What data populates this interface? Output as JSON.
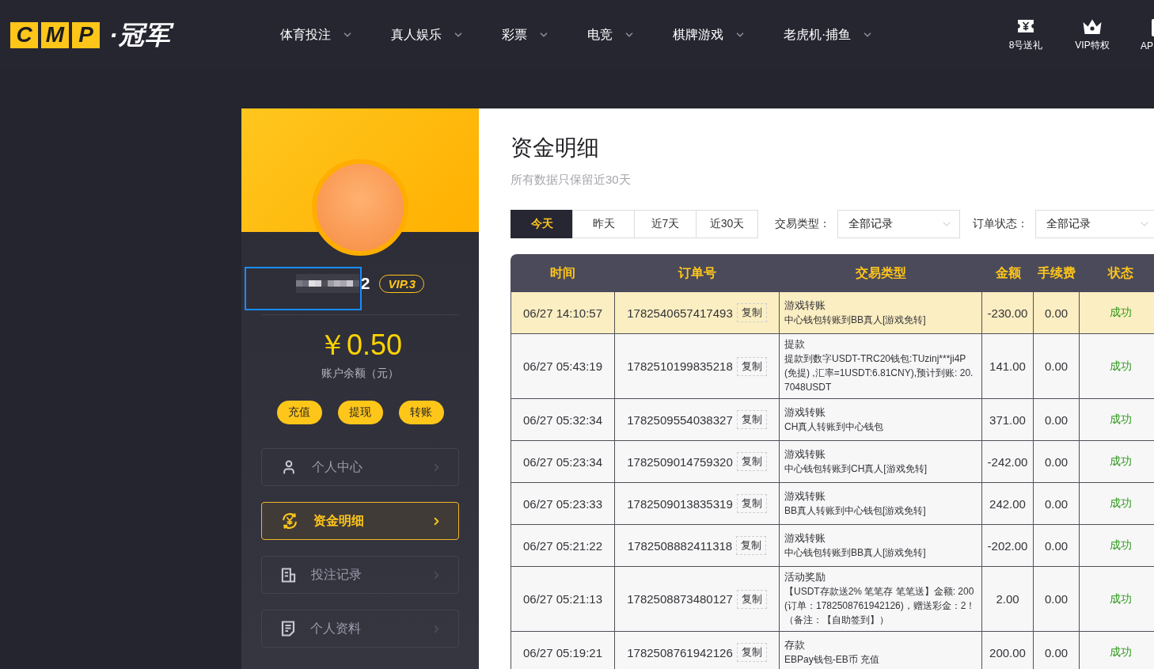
{
  "header": {
    "logo": {
      "letters": [
        "C",
        "M",
        "P"
      ],
      "name": "·冠军"
    },
    "nav": [
      {
        "label": "体育投注"
      },
      {
        "label": "真人娱乐"
      },
      {
        "label": "彩票"
      },
      {
        "label": "电竞"
      },
      {
        "label": "棋牌游戏"
      },
      {
        "label": "老虎机·捕鱼"
      }
    ],
    "actions": [
      {
        "kind": "ticket",
        "label": "8号送礼"
      },
      {
        "kind": "crown",
        "label": "VIP特权"
      },
      {
        "kind": "app",
        "label": "AP"
      }
    ]
  },
  "sidebar": {
    "username": "2",
    "name_highlighted": true,
    "vip": "VIP.3",
    "balance": "￥0.50",
    "balance_label": "账户余额（元）",
    "buttons": [
      "充值",
      "提现",
      "转账"
    ],
    "menu": [
      {
        "kind": "user",
        "label": "个人中心",
        "selected": false
      },
      {
        "kind": "yen",
        "label": "资金明细",
        "selected": true
      },
      {
        "kind": "bets",
        "label": "投注记录",
        "selected": false
      },
      {
        "kind": "profile",
        "label": "个人资料",
        "selected": false
      }
    ]
  },
  "main": {
    "title": "资金明细",
    "note": "所有数据只保留近30天",
    "ranges": [
      {
        "label": "今天",
        "selected": true
      },
      {
        "label": "昨天",
        "selected": false
      },
      {
        "label": "近7天",
        "selected": false
      },
      {
        "label": "近30天",
        "selected": false
      }
    ],
    "filters": [
      {
        "label": "交易类型：",
        "value": "全部记录"
      },
      {
        "label": "订单状态：",
        "value": "全部记录"
      }
    ]
  },
  "table": {
    "columns": [
      "时间",
      "订单号",
      "交易类型",
      "金额",
      "手续费",
      "状态"
    ],
    "rows": [
      {
        "time": "06/27 14:10:57",
        "order": "1782540657417493",
        "copy": "复制",
        "type": "游戏转账",
        "detail": "中心钱包转账到BB真人[游戏免转]",
        "amount": "-230.00",
        "fee": "0.00",
        "status": "成功",
        "selected": true
      },
      {
        "time": "06/27 05:43:19",
        "order": "1782510199835218",
        "copy": "复制",
        "type": "提款",
        "detail": "提款到数字USDT-TRC20钱包:TUzinj***ji4P(免提) ,汇率=1USDT:6.81CNY),预计到账: 20.7048USDT",
        "amount": "141.00",
        "fee": "0.00",
        "status": "成功",
        "selected": false
      },
      {
        "time": "06/27 05:32:34",
        "order": "1782509554038327",
        "copy": "复制",
        "type": "游戏转账",
        "detail": "CH真人转账到中心钱包",
        "amount": "371.00",
        "fee": "0.00",
        "status": "成功",
        "selected": false
      },
      {
        "time": "06/27 05:23:34",
        "order": "1782509014759320",
        "copy": "复制",
        "type": "游戏转账",
        "detail": "中心钱包转账到CH真人[游戏免转]",
        "amount": "-242.00",
        "fee": "0.00",
        "status": "成功",
        "selected": false
      },
      {
        "time": "06/27 05:23:33",
        "order": "1782509013835319",
        "copy": "复制",
        "type": "游戏转账",
        "detail": "BB真人转账到中心钱包[游戏免转]",
        "amount": "242.00",
        "fee": "0.00",
        "status": "成功",
        "selected": false
      },
      {
        "time": "06/27 05:21:22",
        "order": "1782508882411318",
        "copy": "复制",
        "type": "游戏转账",
        "detail": "中心钱包转账到BB真人[游戏免转]",
        "amount": "-202.00",
        "fee": "0.00",
        "status": "成功",
        "selected": false
      },
      {
        "time": "06/27 05:21:13",
        "order": "1782508873480127",
        "copy": "复制",
        "type": "活动奖励",
        "detail": "【USDT存款送2% 笔笔存 笔笔送】金额: 200(订单：1782508761942126)，赠送彩金：2！（备注：【自助签到】）",
        "amount": "2.00",
        "fee": "0.00",
        "status": "成功",
        "selected": false
      },
      {
        "time": "06/27 05:19:21",
        "order": "1782508761942126",
        "copy": "复制",
        "type": "存款",
        "detail": "EBPay钱包-EB币 充值",
        "amount": "200.00",
        "fee": "0.00",
        "status": "成功",
        "selected": false
      }
    ]
  }
}
